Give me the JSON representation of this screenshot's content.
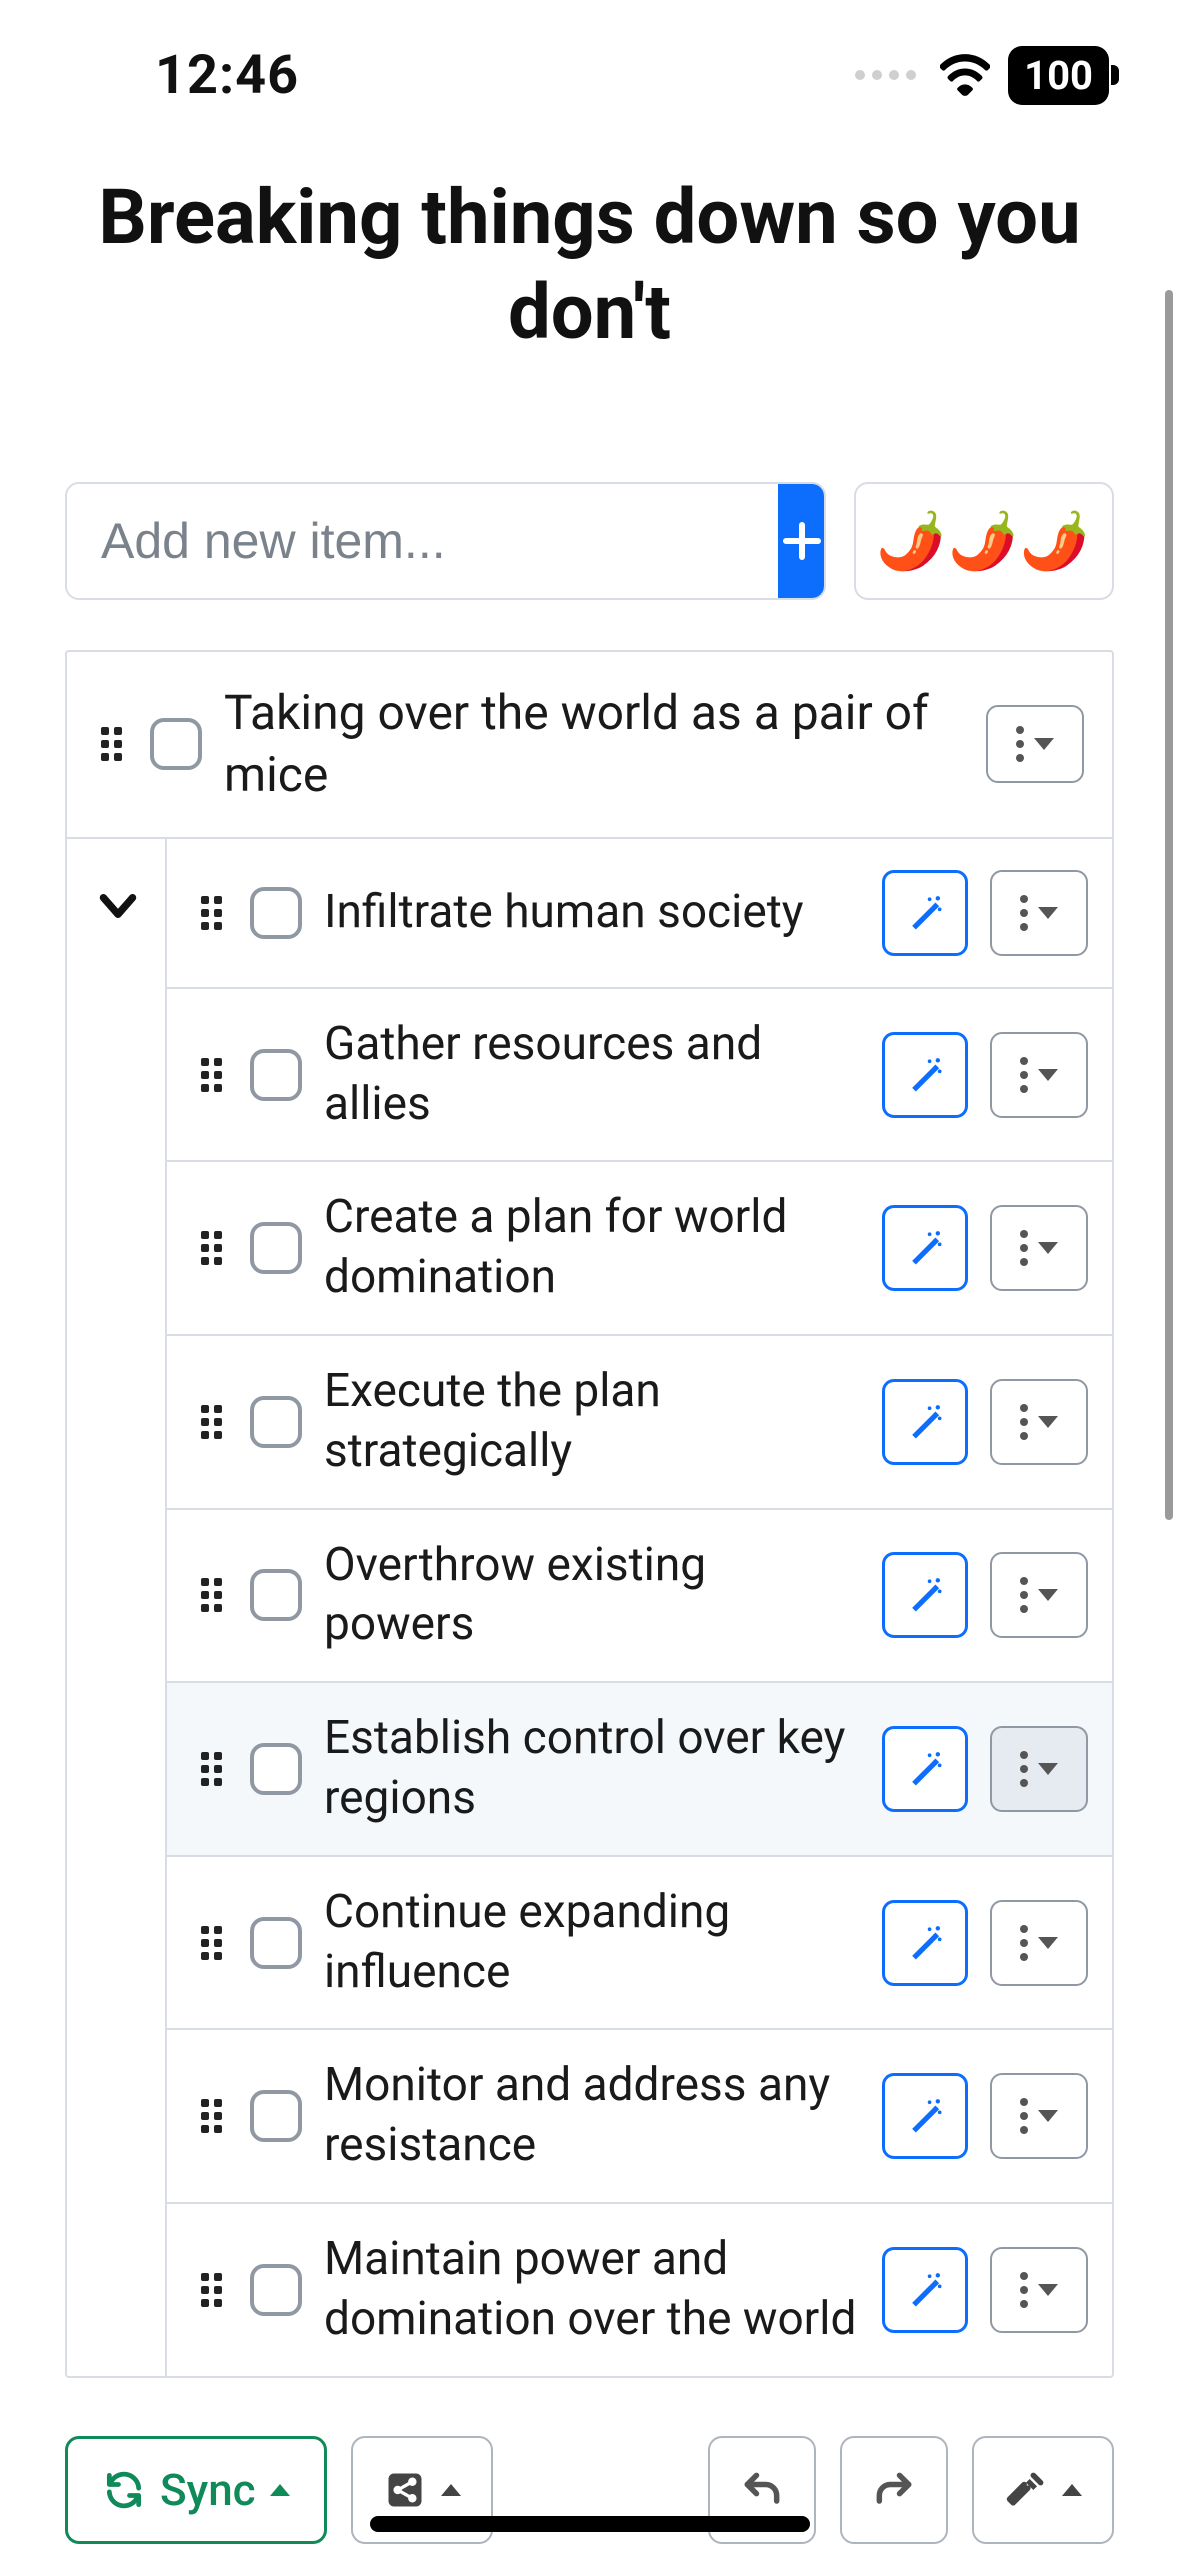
{
  "status": {
    "time": "12:46",
    "battery": "100"
  },
  "header": {
    "title": "Breaking things down so you don't"
  },
  "input": {
    "placeholder": "Add new item...",
    "spice": "🌶️🌶️🌶️"
  },
  "list": {
    "parent": {
      "text": "Taking over the world as a pair of mice"
    },
    "children": [
      {
        "text": "Infiltrate human society",
        "highlight": false
      },
      {
        "text": "Gather resources and allies",
        "highlight": false
      },
      {
        "text": "Create a plan for world domination",
        "highlight": false
      },
      {
        "text": "Execute the plan strategically",
        "highlight": false
      },
      {
        "text": "Overthrow existing powers",
        "highlight": false
      },
      {
        "text": "Establish control over key regions",
        "highlight": true
      },
      {
        "text": "Continue expanding influence",
        "highlight": false
      },
      {
        "text": "Monitor and address any resistance",
        "highlight": false
      },
      {
        "text": "Maintain power and domination over the world",
        "highlight": false
      }
    ]
  },
  "toolbar": {
    "sync_label": "Sync"
  }
}
